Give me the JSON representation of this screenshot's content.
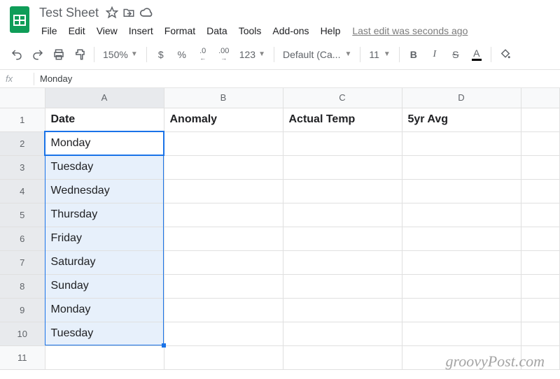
{
  "doc": {
    "title": "Test Sheet",
    "last_edit": "Last edit was seconds ago"
  },
  "menu": {
    "file": "File",
    "edit": "Edit",
    "view": "View",
    "insert": "Insert",
    "format": "Format",
    "data": "Data",
    "tools": "Tools",
    "addons": "Add-ons",
    "help": "Help"
  },
  "toolbar": {
    "zoom": "150%",
    "currency": "$",
    "percent": "%",
    "dec_dec": ".0",
    "inc_dec": ".00",
    "num_format": "123",
    "font": "Default (Ca...",
    "font_size": "11",
    "bold": "B",
    "italic": "I",
    "strike": "S",
    "textcolor": "A"
  },
  "formula_bar": {
    "label": "fx",
    "value": "Monday"
  },
  "columns": [
    "A",
    "B",
    "C",
    "D",
    ""
  ],
  "rows": [
    "1",
    "2",
    "3",
    "4",
    "5",
    "6",
    "7",
    "8",
    "9",
    "10",
    "11"
  ],
  "headers": {
    "A": "Date",
    "B": "Anomaly",
    "C": "Actual Temp",
    "D": "5yr Avg"
  },
  "col_a": [
    "Monday",
    "Tuesday",
    "Wednesday",
    "Thursday",
    "Friday",
    "Saturday",
    "Sunday",
    "Monday",
    "Tuesday"
  ],
  "watermark": "groovyPost.com"
}
